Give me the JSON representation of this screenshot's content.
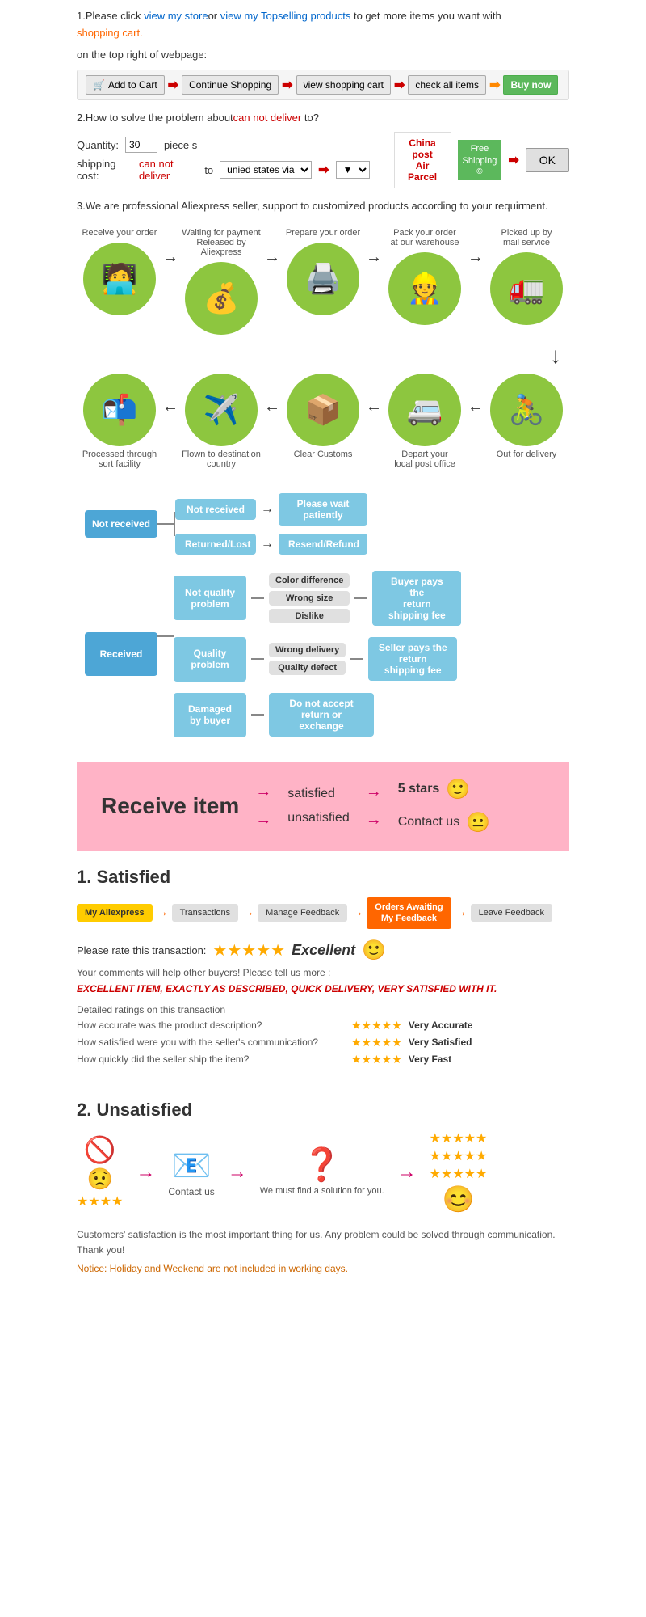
{
  "section1": {
    "text1": "1.Please click ",
    "link1": "view my store",
    "text2": "or ",
    "link2": "view my Topselling products",
    "text3": " to get more items you want with",
    "shopping": "shopping cart.",
    "text4": "on the top right of webpage:",
    "cart_buttons": [
      {
        "label": "Add to Cart",
        "type": "cart"
      },
      {
        "label": "Continue Shopping",
        "type": "normal"
      },
      {
        "label": "view shopping cart",
        "type": "normal"
      },
      {
        "label": "check all items",
        "type": "normal"
      },
      {
        "label": "Buy now",
        "type": "green"
      }
    ]
  },
  "section2": {
    "title": "2.How to solve the problem about",
    "cannotdeliver": "can not deliver",
    "to": " to",
    "questionmark": "?",
    "qty_label": "Quantity:",
    "qty_value": "30",
    "piece": "piece s",
    "shipping_label": "shipping cost:",
    "cannot_deliver": "can not deliver",
    "to2": " to",
    "via": "unied states via",
    "china_post_title1": "China post",
    "china_post_title2": "Air Parcel",
    "free_shipping": "Free\nShipping",
    "ok_label": "OK"
  },
  "section3": {
    "text": "3.We are professional Aliexpress seller, support to customized products according to your requirment."
  },
  "process": {
    "row1": [
      {
        "label": "Receive your order",
        "icon": "🧑‍💻"
      },
      {
        "label": "Waiting for payment\nReleased by Aliexpress",
        "icon": "💰"
      },
      {
        "label": "Prepare your order",
        "icon": "🖨️"
      },
      {
        "label": "Pack your order\nat our warehouse",
        "icon": "👷"
      },
      {
        "label": "Picked up by\nmail service",
        "icon": "🚛"
      }
    ],
    "row2": [
      {
        "label": "Out for delivery",
        "icon": "🚴"
      },
      {
        "label": "Depart your\nlocal post office",
        "icon": "🚐"
      },
      {
        "label": "Clear Customs",
        "icon": "📦"
      },
      {
        "label": "Flown to destination\ncountry",
        "icon": "✈️"
      },
      {
        "label": "Processed through\nsort facility",
        "icon": "📬"
      }
    ]
  },
  "flowchart": {
    "not_received": {
      "label": "Not received",
      "branches": [
        {
          "label": "Not received",
          "result": "Please wait\npatiently"
        },
        {
          "label": "Returned/Lost",
          "result": "Resend/Refund"
        }
      ]
    },
    "received": {
      "label": "Received",
      "branches": [
        {
          "label": "Not quality\nproblem",
          "sub": [
            "Color difference",
            "Wrong size",
            "Dislike"
          ],
          "result": "Buyer pays the\nreturn shipping fee"
        },
        {
          "label": "Quality\nproblem",
          "sub": [
            "Wrong delivery",
            "Quality defect"
          ],
          "result": "Seller pays the\nreturn shipping fee"
        },
        {
          "label": "Damaged\nby buyer",
          "sub": [],
          "result": "Do not accept\nreturn or exchange"
        }
      ]
    }
  },
  "pink_section": {
    "receive_item": "Receive item",
    "satisfied": "satisfied",
    "unsatisfied": "unsatisfied",
    "result1": "5 stars",
    "result2": "Contact us",
    "emoji1": "🙂",
    "emoji2": "😐"
  },
  "satisfied": {
    "title": "1. Satisfied",
    "steps": [
      "My Aliexpress",
      "Transactions",
      "Manage Feedback",
      "Orders Awaiting\nMy Feedback",
      "Leave Feedback"
    ],
    "rate_label": "Please rate this transaction:",
    "excellent": "Excellent",
    "emoji": "🙂",
    "comment": "Your comments will help other buyers! Please tell us more :",
    "quote": "EXCELLENT ITEM, EXACTLY AS DESCRIBED, QUICK DELIVERY, VERY SATISFIED WITH IT.",
    "detailed_label": "Detailed ratings on this transaction",
    "ratings": [
      {
        "label": "How accurate was the product description?",
        "result": "Very Accurate"
      },
      {
        "label": "How satisfied were you with the seller's communication?",
        "result": "Very Satisfied"
      },
      {
        "label": "How quickly did the seller ship the item?",
        "result": "Very Fast"
      }
    ]
  },
  "unsatisfied": {
    "title": "2. Unsatisfied",
    "icons": [
      "🚫",
      "😟",
      "📧",
      "❓",
      "😊"
    ],
    "contact_label": "Contact us",
    "solution_label": "We must find\na solution for\nyou.",
    "notice": "Customers' satisfaction is the most important thing for us. Any problem could be solved through communication. Thank you!",
    "notice_holiday": "Notice: Holiday and Weekend are not included in working days."
  }
}
